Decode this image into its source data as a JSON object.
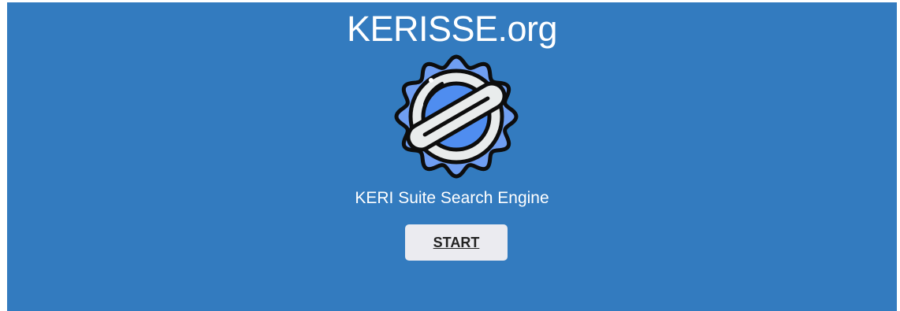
{
  "header": {
    "title": "KERISSE.org"
  },
  "logo": {
    "icon": "seal-badge-icon",
    "colors": {
      "outer": "#6f9ef2",
      "ring": "#e9ecec",
      "inner": "#4f8df0",
      "stroke": "#0d0d0d"
    }
  },
  "main": {
    "tagline": "KERI Suite Search Engine",
    "start_label": "START"
  },
  "theme": {
    "background": "#337bbf",
    "button_bg": "#ebebf0"
  }
}
